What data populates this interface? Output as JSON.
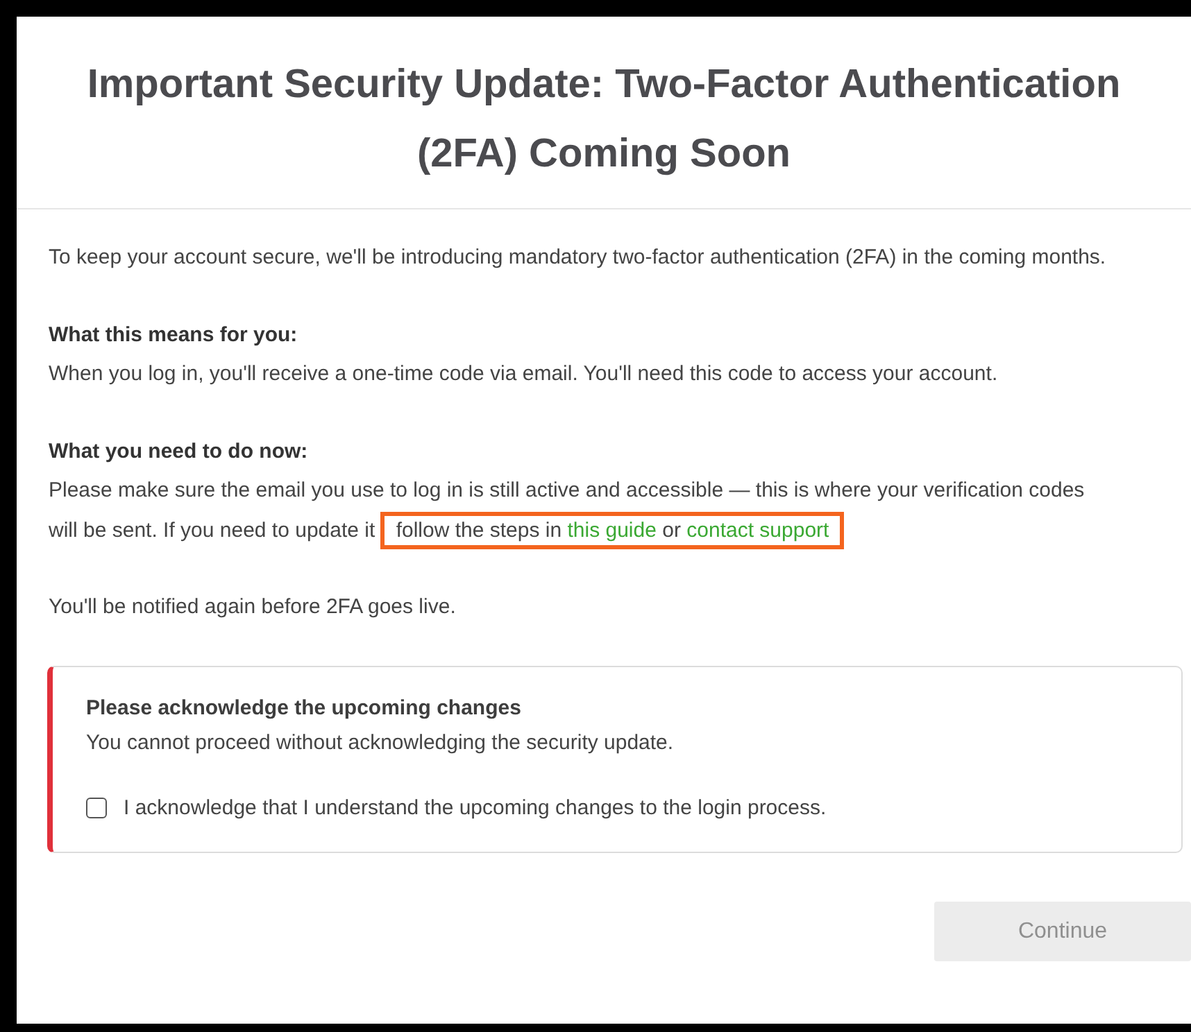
{
  "title": "Important Security Update: Two-Factor Authentication (2FA) Coming Soon",
  "intro": "To keep your account secure, we'll be introducing mandatory two-factor authentication (2FA) in the coming months.",
  "sections": [
    {
      "heading": "What this means for you:",
      "text": "When you log in, you'll receive a one-time code via email. You'll need this code to access your account."
    },
    {
      "heading": "What you need to do now:",
      "text": "Please make sure the email you use to log in is still active and accessible — this is where your verification codes will be sent. If you need to update it",
      "highlight": [
        {
          "kind": "text",
          "text": "follow the steps in"
        },
        {
          "kind": "link",
          "text": "this guide"
        },
        {
          "kind": "text",
          "text": "or"
        },
        {
          "kind": "link",
          "text": "contact support"
        }
      ]
    }
  ],
  "note": "You'll be notified again before 2FA goes live.",
  "notice": {
    "title": "Please acknowledge the upcoming changes",
    "text": "You cannot proceed without acknowledging the security update.",
    "checkbox": {
      "label": "I acknowledge that I understand the upcoming changes to the login process.",
      "checked": false
    }
  },
  "button": {
    "label": "Continue",
    "disabled": true
  }
}
